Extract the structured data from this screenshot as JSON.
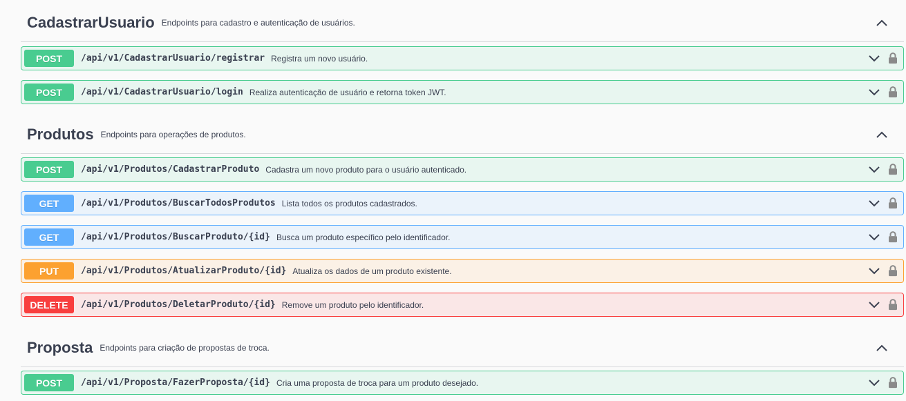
{
  "tags": [
    {
      "name": "CadastrarUsuario",
      "description": "Endpoints para cadastro e autenticação de usuários.",
      "operations": [
        {
          "method": "POST",
          "path": "/api/v1/CadastrarUsuario/registrar",
          "summary": "Registra um novo usuário."
        },
        {
          "method": "POST",
          "path": "/api/v1/CadastrarUsuario/login",
          "summary": "Realiza autenticação de usuário e retorna token JWT."
        }
      ]
    },
    {
      "name": "Produtos",
      "description": "Endpoints para operações de produtos.",
      "operations": [
        {
          "method": "POST",
          "path": "/api/v1/Produtos/CadastrarProduto",
          "summary": "Cadastra um novo produto para o usuário autenticado."
        },
        {
          "method": "GET",
          "path": "/api/v1/Produtos/BuscarTodosProdutos",
          "summary": "Lista todos os produtos cadastrados."
        },
        {
          "method": "GET",
          "path": "/api/v1/Produtos/BuscarProduto/{id}",
          "summary": "Busca um produto específico pelo identificador."
        },
        {
          "method": "PUT",
          "path": "/api/v1/Produtos/AtualizarProduto/{id}",
          "summary": "Atualiza os dados de um produto existente."
        },
        {
          "method": "DELETE",
          "path": "/api/v1/Produtos/DeletarProduto/{id}",
          "summary": "Remove um produto pelo identificador."
        }
      ]
    },
    {
      "name": "Proposta",
      "description": "Endpoints para criação de propostas de troca.",
      "operations": [
        {
          "method": "POST",
          "path": "/api/v1/Proposta/FazerProposta/{id}",
          "summary": "Cria uma proposta de troca para um produto desejado."
        }
      ]
    }
  ],
  "colors": {
    "POST": "#49cc90",
    "GET": "#61affe",
    "PUT": "#fca130",
    "DELETE": "#f93e3e"
  },
  "icons": {
    "tag_toggle": "chevron-up-icon",
    "operation_toggle": "chevron-down-icon",
    "auth": "lock-icon"
  }
}
